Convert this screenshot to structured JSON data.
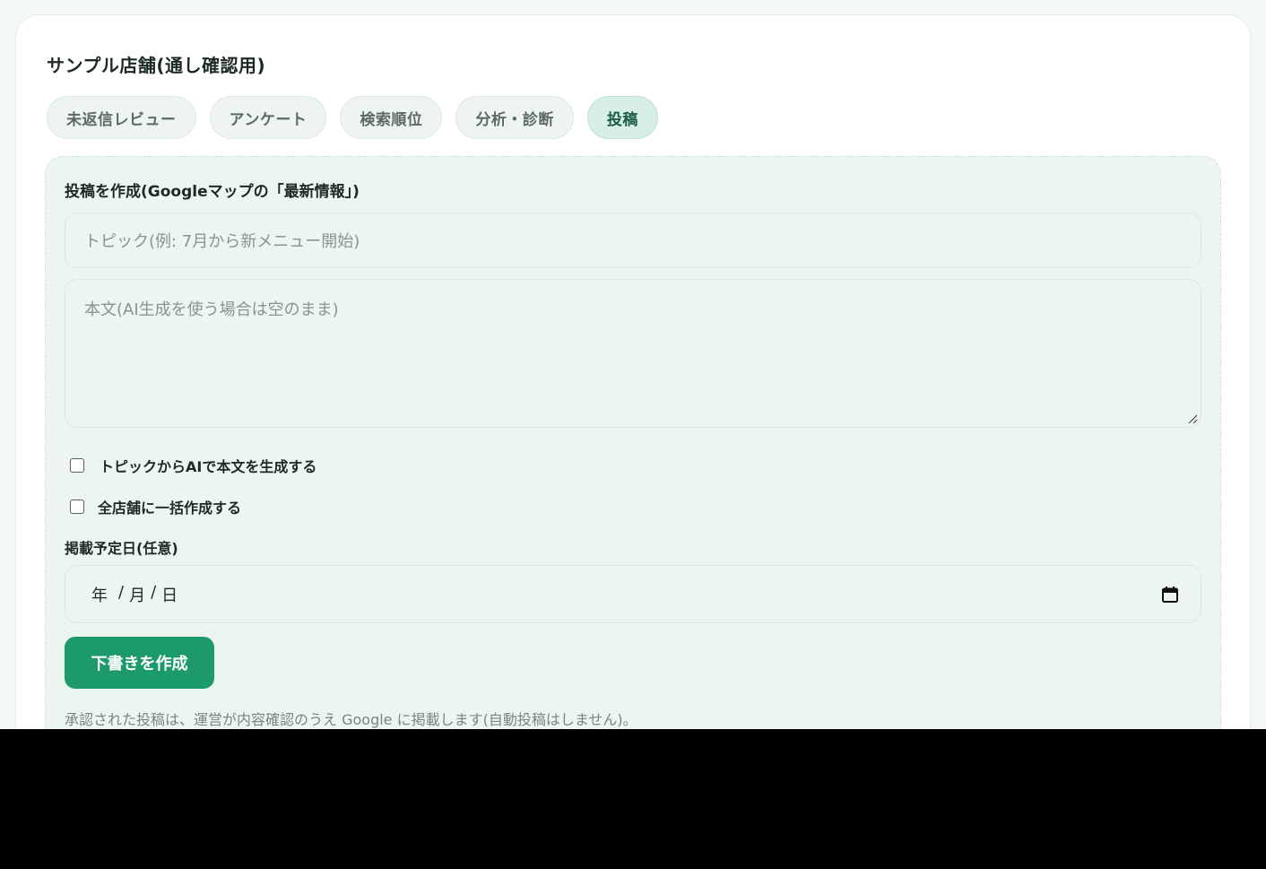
{
  "store": {
    "title": "サンプル店舗(通し確認用)"
  },
  "tabs": [
    {
      "label": "未返信レビュー",
      "active": false
    },
    {
      "label": "アンケート",
      "active": false
    },
    {
      "label": "検索順位",
      "active": false
    },
    {
      "label": "分析・診断",
      "active": false
    },
    {
      "label": "投稿",
      "active": true
    }
  ],
  "post_form": {
    "title": "投稿を作成(Googleマップの「最新情報」)",
    "topic_placeholder": "トピック(例: 7月から新メニュー開始)",
    "topic_value": "",
    "body_placeholder": "本文(AI生成を使う場合は空のまま)",
    "body_value": "",
    "ai_generate_label": "トピックからAIで本文を生成する",
    "ai_generate_checked": false,
    "all_stores_label": "全店舗に一括作成する",
    "all_stores_checked": false,
    "date_label": "掲載予定日(任意)",
    "date_parts": {
      "year": "年",
      "sep1": "/",
      "month": "月",
      "sep2": "/",
      "day": "日"
    },
    "calendar_icon": "calendar-icon",
    "submit_label": "下書きを作成",
    "note": "承認された投稿は、運営が内容確認のうえ Google に掲載します(自動投稿はしません)。"
  },
  "colors": {
    "accent": "#1d9a6c",
    "panel_bg": "#edf5f1",
    "active_tab_bg": "#d7efe4"
  }
}
